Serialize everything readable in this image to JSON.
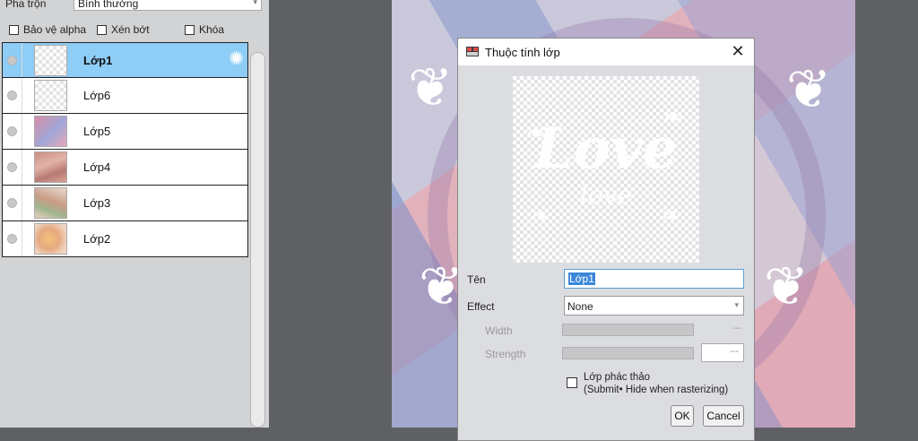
{
  "blend": {
    "label": "Pha trộn",
    "value": "Bình thường"
  },
  "options": [
    {
      "label": "Bảo vệ alpha"
    },
    {
      "label": "Xén bớt"
    },
    {
      "label": "Khóa"
    }
  ],
  "layers": [
    {
      "name": "Lớp1",
      "selected": true
    },
    {
      "name": "Lớp6"
    },
    {
      "name": "Lớp5"
    },
    {
      "name": "Lớp4"
    },
    {
      "name": "Lớp3"
    },
    {
      "name": "Lớp2"
    }
  ],
  "dialog": {
    "title": "Thuộc tính lớp",
    "preview": {
      "text_large": "Love",
      "text_small": "love"
    },
    "name_label": "Tên",
    "name_value": "Lớp1",
    "effect_label": "Effect",
    "effect_value": "None",
    "width_label": "Width",
    "width_value": "---",
    "strength_label": "Strength",
    "strength_value": "---",
    "draft_line1": "Lớp phác thảo",
    "draft_line2": "(Submit• Hide when rasterizing)",
    "ok_label": "OK",
    "cancel_label": "Cancel"
  },
  "colors": {
    "selected_layer": "#8ecdf6",
    "name_selection": "#3a86d8"
  },
  "icons": {
    "gear": "gear-icon",
    "close": "close-icon",
    "app": "app-icon",
    "chevron": "chevron-down-icon"
  }
}
